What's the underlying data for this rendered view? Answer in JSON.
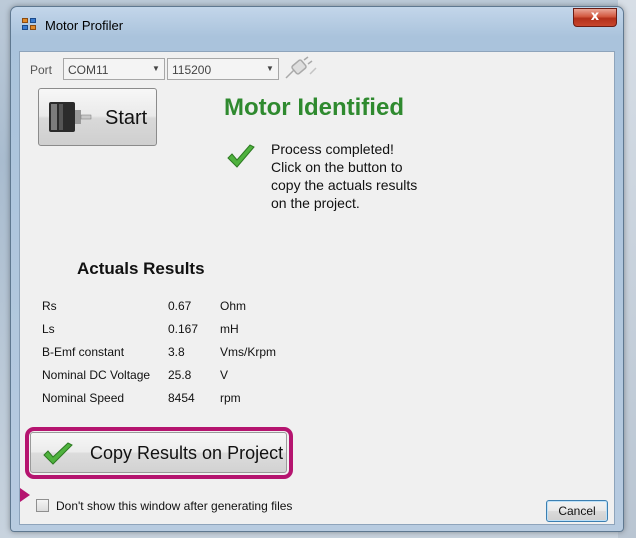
{
  "window": {
    "title": "Motor Profiler",
    "close_glyph": "x"
  },
  "connection": {
    "port_label": "Port",
    "port_value": "COM11",
    "baud_value": "115200",
    "connect_icon": "plug-icon"
  },
  "start": {
    "label": "Start",
    "icon": "motor-icon"
  },
  "status": {
    "title": "Motor Identified",
    "title_color": "#2f8a2f",
    "icon": "check-icon",
    "message_lines": [
      "Process completed!",
      "Click on the button to",
      "copy the actuals results",
      "on the project."
    ]
  },
  "results": {
    "title": "Actuals Results",
    "rows": [
      {
        "name": "Rs",
        "value": "0.67",
        "unit": "Ohm"
      },
      {
        "name": "Ls",
        "value": "0.167",
        "unit": "mH"
      },
      {
        "name": "B-Emf constant",
        "value": "3.8",
        "unit": "Vms/Krpm"
      },
      {
        "name": "Nominal DC Voltage",
        "value": "25.8",
        "unit": "V"
      },
      {
        "name": "Nominal Speed",
        "value": "8454",
        "unit": "rpm"
      }
    ]
  },
  "copy_button": {
    "label": "Copy Results on Project",
    "highlight_color": "#b5146f"
  },
  "footer": {
    "checkbox_label": "Don't show this window after generating files",
    "checkbox_checked": false,
    "cancel_label": "Cancel"
  }
}
